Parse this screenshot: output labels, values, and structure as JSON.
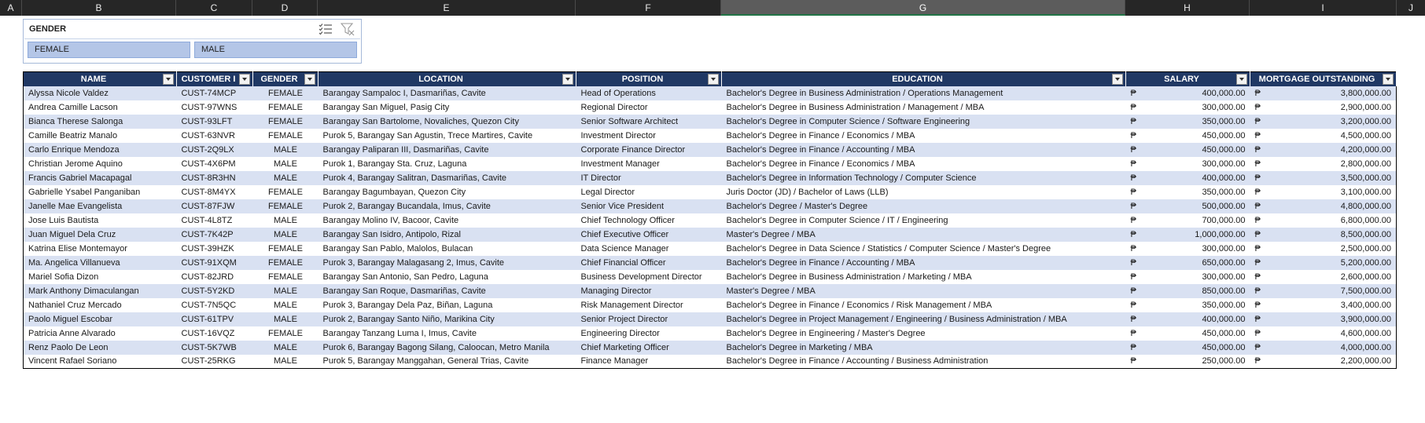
{
  "column_headers": [
    "A",
    "B",
    "C",
    "D",
    "E",
    "F",
    "G",
    "H",
    "I",
    "J"
  ],
  "slicer": {
    "title": "GENDER",
    "options": [
      "FEMALE",
      "MALE"
    ],
    "icons": [
      "multi-select-icon",
      "clear-filter-icon"
    ]
  },
  "table": {
    "headers": [
      "NAME",
      "CUSTOMER I",
      "GENDER",
      "LOCATION",
      "POSITION",
      "EDUCATION",
      "SALARY",
      "MORTGAGE OUTSTANDING"
    ],
    "currency_symbol": "₱",
    "colors": {
      "header_bg": "#203864",
      "band": "#d9e1f2",
      "slicer_btn": "#b4c6e7"
    },
    "rows": [
      [
        "Alyssa Nicole Valdez",
        "CUST-74MCP",
        "FEMALE",
        "Barangay Sampaloc I, Dasmariñas, Cavite",
        "Head of Operations",
        "Bachelor's Degree in Business Administration / Operations Management",
        "400,000.00",
        "3,800,000.00"
      ],
      [
        "Andrea Camille Lacson",
        "CUST-97WNS",
        "FEMALE",
        "Barangay San Miguel, Pasig City",
        "Regional Director",
        "Bachelor's Degree in Business Administration / Management / MBA",
        "300,000.00",
        "2,900,000.00"
      ],
      [
        "Bianca Therese Salonga",
        "CUST-93LFT",
        "FEMALE",
        "Barangay San Bartolome, Novaliches, Quezon City",
        "Senior Software Architect",
        "Bachelor's Degree in Computer Science / Software Engineering",
        "350,000.00",
        "3,200,000.00"
      ],
      [
        "Camille Beatriz Manalo",
        "CUST-63NVR",
        "FEMALE",
        "Purok 5, Barangay San Agustin, Trece Martires, Cavite",
        "Investment Director",
        "Bachelor's Degree in Finance / Economics / MBA",
        "450,000.00",
        "4,500,000.00"
      ],
      [
        "Carlo Enrique Mendoza",
        "CUST-2Q9LX",
        "MALE",
        "Barangay Paliparan III, Dasmariñas, Cavite",
        "Corporate Finance Director",
        "Bachelor's Degree in Finance / Accounting / MBA",
        "450,000.00",
        "4,200,000.00"
      ],
      [
        "Christian Jerome Aquino",
        "CUST-4X6PM",
        "MALE",
        "Purok 1, Barangay Sta. Cruz, Laguna",
        "Investment Manager",
        "Bachelor's Degree in Finance / Economics / MBA",
        "300,000.00",
        "2,800,000.00"
      ],
      [
        "Francis Gabriel Macapagal",
        "CUST-8R3HN",
        "MALE",
        "Purok 4, Barangay Salitran, Dasmariñas, Cavite",
        "IT Director",
        "Bachelor's Degree in Information Technology / Computer Science",
        "400,000.00",
        "3,500,000.00"
      ],
      [
        "Gabrielle Ysabel Panganiban",
        "CUST-8M4YX",
        "FEMALE",
        "Barangay Bagumbayan, Quezon City",
        "Legal Director",
        "Juris Doctor (JD) / Bachelor of Laws (LLB)",
        "350,000.00",
        "3,100,000.00"
      ],
      [
        "Janelle Mae Evangelista",
        "CUST-87FJW",
        "FEMALE",
        "Purok 2, Barangay Bucandala, Imus, Cavite",
        "Senior Vice President",
        "Bachelor's Degree / Master's Degree",
        "500,000.00",
        "4,800,000.00"
      ],
      [
        "Jose Luis Bautista",
        "CUST-4L8TZ",
        "MALE",
        "Barangay Molino IV, Bacoor, Cavite",
        "Chief Technology Officer",
        "Bachelor's Degree in Computer Science / IT / Engineering",
        "700,000.00",
        "6,800,000.00"
      ],
      [
        "Juan Miguel Dela Cruz",
        "CUST-7K42P",
        "MALE",
        "Barangay San Isidro, Antipolo, Rizal",
        "Chief Executive Officer",
        "Master's Degree / MBA",
        "1,000,000.00",
        "8,500,000.00"
      ],
      [
        "Katrina Elise Montemayor",
        "CUST-39HZK",
        "FEMALE",
        "Barangay San Pablo, Malolos, Bulacan",
        "Data Science Manager",
        "Bachelor's Degree in Data Science / Statistics / Computer Science / Master's Degree",
        "300,000.00",
        "2,500,000.00"
      ],
      [
        "Ma. Angelica Villanueva",
        "CUST-91XQM",
        "FEMALE",
        "Purok 3, Barangay Malagasang 2, Imus, Cavite",
        "Chief Financial Officer",
        "Bachelor's Degree in Finance / Accounting / MBA",
        "650,000.00",
        "5,200,000.00"
      ],
      [
        "Mariel Sofia Dizon",
        "CUST-82JRD",
        "FEMALE",
        "Barangay San Antonio, San Pedro, Laguna",
        "Business Development Director",
        "Bachelor's Degree in Business Administration / Marketing / MBA",
        "300,000.00",
        "2,600,000.00"
      ],
      [
        "Mark Anthony Dimaculangan",
        "CUST-5Y2KD",
        "MALE",
        "Barangay San Roque, Dasmariñas, Cavite",
        "Managing Director",
        "Master's Degree / MBA",
        "850,000.00",
        "7,500,000.00"
      ],
      [
        "Nathaniel Cruz Mercado",
        "CUST-7N5QC",
        "MALE",
        "Purok 3, Barangay Dela Paz, Biñan, Laguna",
        "Risk Management Director",
        "Bachelor's Degree in Finance / Economics / Risk Management / MBA",
        "350,000.00",
        "3,400,000.00"
      ],
      [
        "Paolo Miguel Escobar",
        "CUST-61TPV",
        "MALE",
        "Purok 2, Barangay Santo Niño, Marikina City",
        "Senior Project Director",
        "Bachelor's Degree in Project Management / Engineering / Business Administration / MBA",
        "400,000.00",
        "3,900,000.00"
      ],
      [
        "Patricia Anne Alvarado",
        "CUST-16VQZ",
        "FEMALE",
        "Barangay Tanzang Luma I, Imus, Cavite",
        "Engineering Director",
        "Bachelor's Degree in Engineering / Master's Degree",
        "450,000.00",
        "4,600,000.00"
      ],
      [
        "Renz Paolo De Leon",
        "CUST-5K7WB",
        "MALE",
        "Purok 6, Barangay Bagong Silang, Caloocan, Metro Manila",
        "Chief Marketing Officer",
        "Bachelor's Degree in Marketing / MBA",
        "450,000.00",
        "4,000,000.00"
      ],
      [
        "Vincent Rafael Soriano",
        "CUST-25RKG",
        "MALE",
        "Purok 5, Barangay Manggahan, General Trias, Cavite",
        "Finance Manager",
        "Bachelor's Degree in Finance / Accounting / Business Administration",
        "250,000.00",
        "2,200,000.00"
      ]
    ]
  }
}
